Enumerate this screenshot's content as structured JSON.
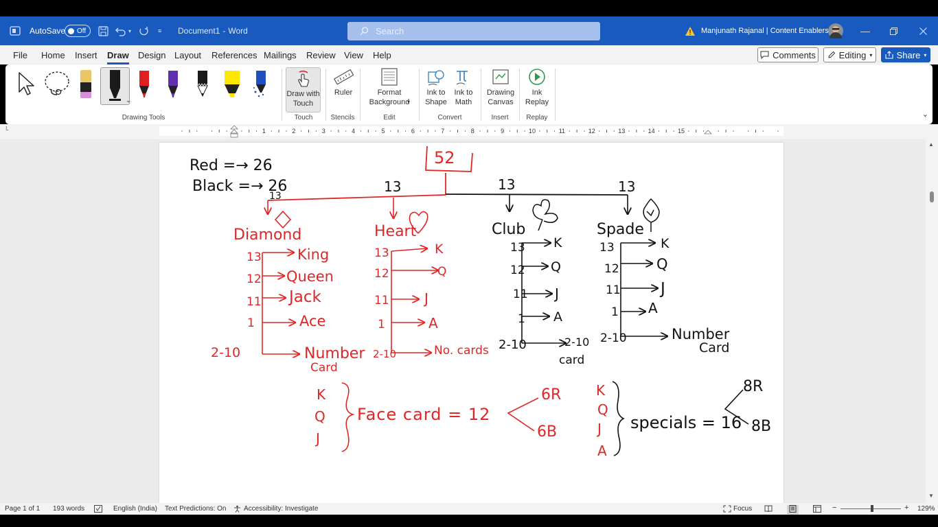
{
  "titlebar": {
    "autosave_label": "AutoSave",
    "autosave_state": "Off",
    "doc_title": "Document1",
    "separator": "-",
    "app_name": "Word",
    "search_placeholder": "Search",
    "user_name": "Manjunath Rajanal | Content Enablers"
  },
  "menu": {
    "items": [
      "File",
      "Home",
      "Insert",
      "Draw",
      "Design",
      "Layout",
      "References",
      "Mailings",
      "Review",
      "View",
      "Help"
    ],
    "active": "Draw",
    "comments": "Comments",
    "editing": "Editing",
    "share": "Share"
  },
  "ribbon": {
    "drawing_tools_label": "Drawing Tools",
    "draw_with_touch": "Draw with Touch",
    "touch_label": "Touch",
    "ruler": "Ruler",
    "stencils_label": "Stencils",
    "format_background": "Format Background",
    "edit_label": "Edit",
    "ink_to_shape": "Ink to Shape",
    "ink_to_math": "Ink to Math",
    "convert_label": "Convert",
    "drawing_canvas": "Drawing Canvas",
    "insert_label": "Insert",
    "ink_replay": "Ink Replay",
    "replay_label": "Replay",
    "pen_colors": [
      "#e9c767",
      "#1a1a1a",
      "#e02020",
      "#6030b0",
      "#1a1a1a",
      "#ffe800",
      "#2050c0"
    ]
  },
  "ruler": {
    "numbers": [
      "1",
      "2",
      "3",
      "4",
      "5",
      "6",
      "7",
      "8",
      "9",
      "10",
      "11",
      "12",
      "13",
      "14",
      "15"
    ]
  },
  "ink": {
    "total": "52",
    "red_line": "Red =→ 26",
    "black_line": "Black =→ 26",
    "count_13": "13",
    "diamond": "Diamond",
    "heart": "Heart",
    "club": "Club",
    "spade": "Spade",
    "diamond_rows": [
      [
        "13",
        "King"
      ],
      [
        "12",
        "Queen"
      ],
      [
        "11",
        "Jack"
      ],
      [
        "1",
        "Ace"
      ],
      [
        "2-10",
        "Number"
      ]
    ],
    "diamond_card": "Card",
    "heart_rows": [
      [
        "13",
        "K"
      ],
      [
        "12",
        "Q"
      ],
      [
        "11",
        "J"
      ],
      [
        "1",
        "A"
      ],
      [
        "2-10",
        "No. cards"
      ]
    ],
    "club_rows": [
      [
        "13",
        "K"
      ],
      [
        "12",
        "Q"
      ],
      [
        "11",
        "J"
      ],
      [
        "1",
        "A"
      ],
      [
        "2-10",
        "2-10"
      ]
    ],
    "club_card": "card",
    "spade_rows": [
      [
        "13",
        "K"
      ],
      [
        "12",
        "Q"
      ],
      [
        "11",
        "J"
      ],
      [
        "1",
        "A"
      ],
      [
        "2-10",
        "Number"
      ]
    ],
    "spade_card": "Card",
    "face_letters": [
      "K",
      "Q",
      "J"
    ],
    "face_card_text": "Face card = 12",
    "face_6r": "6R",
    "face_6b": "6B",
    "special_letters": [
      "K",
      "Q",
      "J",
      "A"
    ],
    "specials_text": "specials = 16",
    "special_8r": "8R",
    "special_8b": "8B",
    "red_color": "#e02626",
    "black_color": "#111111"
  },
  "status": {
    "page": "Page 1 of 1",
    "words": "193 words",
    "language": "English (India)",
    "predictions": "Text Predictions: On",
    "accessibility": "Accessibility: Investigate",
    "focus": "Focus",
    "zoom": "129%"
  }
}
